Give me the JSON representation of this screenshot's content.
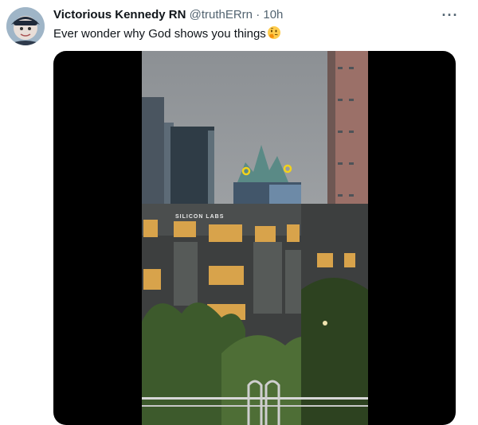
{
  "tweet": {
    "author_name": "Victorious Kennedy RN",
    "handle": "@truthERrn",
    "separator": "·",
    "time": "10h",
    "text": "Ever wonder why God shows you things",
    "emoji": "thinking-face-icon",
    "more_label": "···"
  },
  "media": {
    "building_sign": "SILICON LABS"
  },
  "colors": {
    "text_primary": "#0f1419",
    "text_secondary": "#536471",
    "media_background": "#000000"
  }
}
